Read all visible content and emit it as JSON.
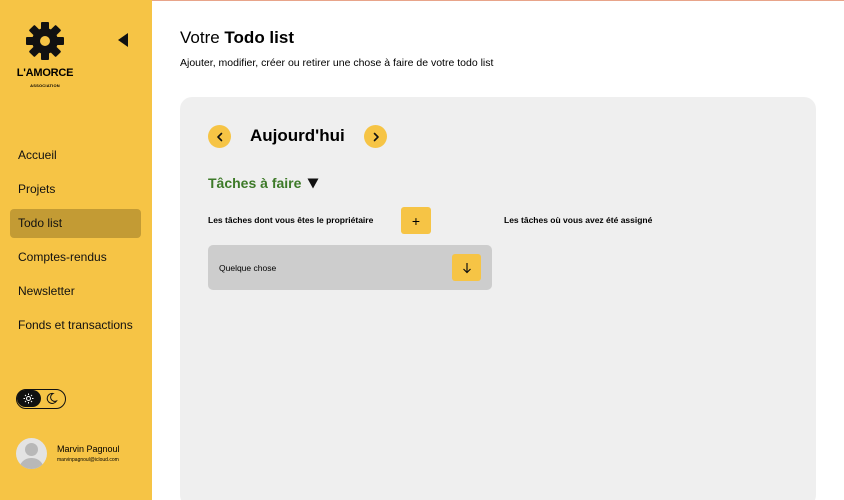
{
  "sidebar": {
    "logo": {
      "name": "L'AMORCE",
      "subtitle": "ASSOCIATION"
    },
    "nav": [
      {
        "label": "Accueil",
        "active": false
      },
      {
        "label": "Projets",
        "active": false
      },
      {
        "label": "Todo list",
        "active": true
      },
      {
        "label": "Comptes-rendus",
        "active": false
      },
      {
        "label": "Newsletter",
        "active": false
      },
      {
        "label": "Fonds et transactions",
        "active": false
      }
    ],
    "theme": {
      "selected": "light",
      "options": [
        "sun-icon",
        "moon-icon"
      ]
    },
    "user": {
      "name": "Marvin Pagnoul",
      "email": "marvinpagnoul@icloud.com"
    }
  },
  "header": {
    "title_prefix": "Votre ",
    "title_bold": "Todo list",
    "subtitle": "Ajouter, modifier, créer ou retirer une chose à faire de votre todo list"
  },
  "day_nav": {
    "label": "Aujourd'hui"
  },
  "section": {
    "title": "Tâches à faire",
    "toggle_icon": "triangle-down-icon"
  },
  "columns": {
    "owner_label": "Les tâches dont vous êtes le propriétaire",
    "assigned_label": "Les tâches où vous avez été assigné",
    "add_label": "+"
  },
  "tasks": [
    {
      "text": "Quelque chose"
    }
  ],
  "colors": {
    "accent": "#f6c445",
    "sidebar_active": "#c39b34",
    "section_title": "#3d7a28",
    "panel": "#efefef",
    "card": "#cdcdcd"
  }
}
